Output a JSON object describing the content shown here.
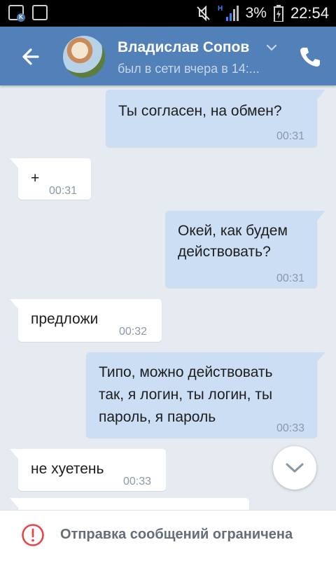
{
  "status_bar": {
    "battery": "3%",
    "time": "22:54",
    "network": "H"
  },
  "header": {
    "contact_name": "Владислав Сопов",
    "last_seen": "был в сети вчера в 14:...",
    "accent_color": "#5181b8"
  },
  "messages": [
    {
      "dir": "out",
      "text": "Ты согласен, на обмен?",
      "time": "00:31"
    },
    {
      "dir": "in",
      "text": "+",
      "time": "00:31"
    },
    {
      "dir": "out",
      "text_line1": "Окей, как будем",
      "text_line2": "действовать?",
      "time": "00:31"
    },
    {
      "dir": "in",
      "text": "предложи",
      "time": "00:32"
    },
    {
      "dir": "out",
      "text_line1": "Типо, можно действовать",
      "text_line2": "так, я логин, ты логин, ты",
      "text_line3": "пароль, я пароль",
      "time": "00:33"
    },
    {
      "dir": "in",
      "text": "не хуетень",
      "time": "00:33"
    }
  ],
  "composer": {
    "restricted_text": "Отправка сообщений ограничена"
  }
}
